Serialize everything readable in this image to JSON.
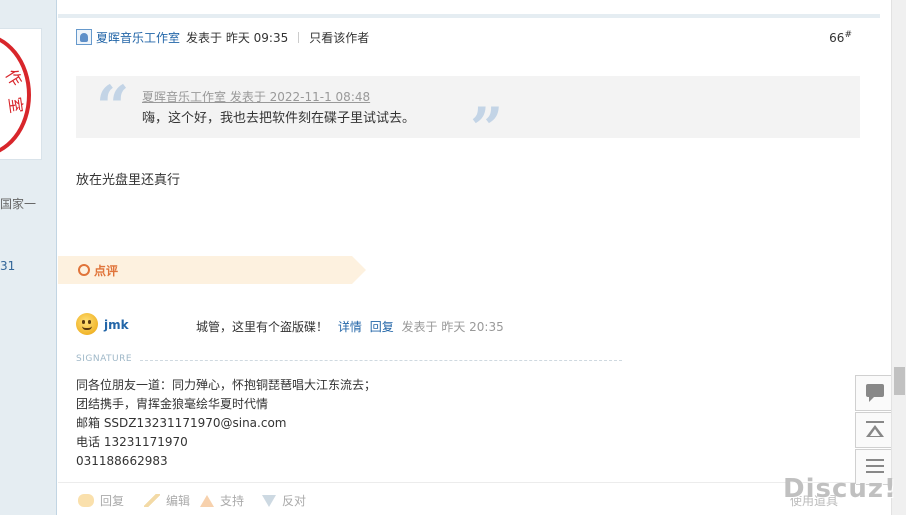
{
  "seal": {
    "chars_1": "作",
    "chars_2": "室"
  },
  "sidebar": {
    "text1": "国家一",
    "text2": "31"
  },
  "post": {
    "author": "夏晖音乐工作室",
    "posted": "发表于 昨天 09:35",
    "only_author": "只看该作者",
    "floor": "66",
    "floor_mark": "#",
    "quote": {
      "meta": "夏晖音乐工作室 发表于 2022-11-1 08:48",
      "body": "嗨，这个好，我也去把软件刻在碟子里试试去。"
    },
    "body": "放在光盘里还真行"
  },
  "comment_section": {
    "label": "点评",
    "comment": {
      "user": "jmk",
      "text": "城管，这里有个盗版碟！",
      "detail": "详情",
      "reply": "回复",
      "time": "发表于 昨天 20:35"
    }
  },
  "signature": {
    "label": "SIGNATURE",
    "lines": [
      "同各位朋友一道：同力殚心，怀抱铜琵琶唱大江东流去；",
      "团结携手，胄挥金狼毫绘华夏时代情",
      "邮箱 SSDZ13231171970@sina.com",
      "电话 13231171970",
      "031188662983"
    ]
  },
  "actions": {
    "reply": "回复",
    "edit": "编辑",
    "support": "支持",
    "oppose": "反对",
    "use": "使用道具"
  },
  "float_bar": {
    "icons": [
      "reply-icon",
      "back-to-top-icon",
      "list-icon"
    ]
  },
  "watermark": "Discuz!"
}
